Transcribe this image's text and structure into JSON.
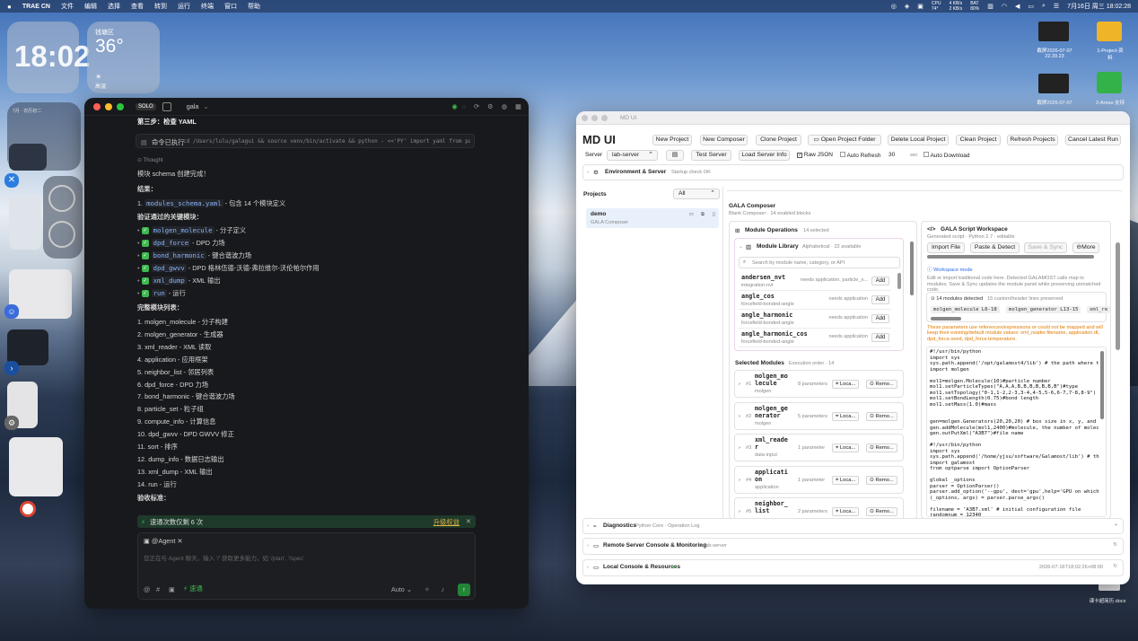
{
  "menubar": {
    "app": "TRAE CN",
    "items": [
      "文件",
      "编辑",
      "选择",
      "查看",
      "转到",
      "运行",
      "终端",
      "窗口",
      "帮助"
    ],
    "cpu_label": "CPU",
    "cpu_temp": "74°",
    "net_up": "4 KB/s",
    "net_down": "2 KB/s",
    "battery_label": "BAT",
    "battery": "80%",
    "datetime": "7月16日 周三 18:02:28"
  },
  "widgets": {
    "clock": "18:02",
    "weather_city": "钱塘区",
    "weather_temp": "36°",
    "weather_cond": "高温",
    "calendar_title": "7月 · 农历初二"
  },
  "desktop_files": [
    {
      "name": "截屏2026-07-07",
      "sub": "22.39.23"
    },
    {
      "name": "1-Project-资",
      "sub": "料"
    },
    {
      "name": "截屏2026-07-07",
      "sub": ""
    },
    {
      "name": "2-Areas-支持",
      "sub": ""
    },
    {
      "name": "课卡超简历.docx",
      "sub": ""
    }
  ],
  "trae": {
    "project": "gala",
    "solo": "SOLO",
    "step": "第三步：检查 YAML",
    "command_label": "命令已执行",
    "command": "cd /Users/lulu/galagui && source venv/bin/activate && python - <<'PY' import yaml from pathlib import Path p = P...",
    "thought": "Thought",
    "done": "模块 schema 创建完成！",
    "result_title": "结果：",
    "result_item_num": "1.",
    "result_file": "modules_schema.yaml",
    "result_desc": "- 包含 14 个模块定义",
    "verified_title": "验证通过的关键模块：",
    "verified": [
      {
        "code": "molgen_molecule",
        "desc": "- 分子定义"
      },
      {
        "code": "dpd_force",
        "desc": "- DPD 力场"
      },
      {
        "code": "bond_harmonic",
        "desc": "- 键合谐波力场"
      },
      {
        "code": "dpd_gwvv",
        "desc": "- DPD 格林伍德-沃德-弗拉维尔-沃伦帕尔作用"
      },
      {
        "code": "xml_dump",
        "desc": "- XML 输出"
      },
      {
        "code": "run",
        "desc": "- 运行"
      }
    ],
    "full_title": "完整模块列表：",
    "modules": [
      {
        "num": "1.",
        "text": "molgen_molecule - 分子构建"
      },
      {
        "num": "2.",
        "text": "molgen_generator - 生成器"
      },
      {
        "num": "3.",
        "text": "xml_reader - XML 读取"
      },
      {
        "num": "4.",
        "text": "application - 应用框架"
      },
      {
        "num": "5.",
        "text": "neighbor_list - 邻居列表"
      },
      {
        "num": "6.",
        "text": "dpd_force - DPD 力场"
      },
      {
        "num": "7.",
        "text": "bond_harmonic - 键合谐波力场"
      },
      {
        "num": "8.",
        "text": "particle_set - 粒子组"
      },
      {
        "num": "9.",
        "text": "compute_info - 计算信息"
      },
      {
        "num": "10.",
        "text": "dpd_gwvv - DPD GWVV 修正"
      },
      {
        "num": "11.",
        "text": "sort - 排序"
      },
      {
        "num": "12.",
        "text": "dump_info - 数据日志输出"
      },
      {
        "num": "13.",
        "text": "xml_dump - XML 输出"
      },
      {
        "num": "14.",
        "text": "run - 运行"
      }
    ],
    "accept_title": "验收标准：",
    "quota": "速通次数仅剩 6 次",
    "upgrade": "升级权益",
    "agent": "@Agent",
    "input_placeholder": "您正在与 Agent 聊天，输入 '/' 获取更多能力，如 '/plan', '/spec'",
    "mode": "Auto",
    "speed": "速通"
  },
  "md": {
    "window_title": "MD UI",
    "app_title": "MD UI",
    "toolbar": [
      "New Project",
      "New Composer",
      "Clone Project",
      "Open Project Folder",
      "Delete Local Project",
      "Clean Project",
      "Refresh Projects",
      "Cancel Latest Run"
    ],
    "server_label": "Server",
    "server_value": "lab-server",
    "test_server": "Test Server",
    "load_info": "Load Server Info",
    "raw_json": "Raw JSON",
    "auto_refresh": "Auto Refresh",
    "refresh_value": "30",
    "sec": "sec",
    "auto_download": "Auto Download",
    "env_title": "Environment & Server",
    "env_status": "Startup check OK",
    "projects_title": "Projects",
    "projects_filter": "All",
    "project_name": "demo",
    "project_sub": "GALA Composer",
    "composer_title": "GALA Composer",
    "composer_sub": "Blank Composer · 14 enabled blocks",
    "module_ops": "Module Operations",
    "module_ops_count": "14 selected",
    "library_title": "Module Library",
    "library_sub": "Alphabetical · 22 available",
    "search_placeholder": "Search by module name, category, or API",
    "library": [
      {
        "name": "andersen_nvt",
        "cat": "integration-nvt",
        "note": "needs application, particle_s...",
        "add": "Add"
      },
      {
        "name": "angle_cos",
        "cat": "forcefield-bonded-angle",
        "note": "needs application",
        "add": "Add"
      },
      {
        "name": "angle_harmonic",
        "cat": "forcefield-bonded-angle",
        "note": "needs application",
        "add": "Add"
      },
      {
        "name": "angle_harmonic_cos",
        "cat": "forcefield-bonded-angle",
        "note": "needs application",
        "add": "Add"
      }
    ],
    "selected_title": "Selected Modules",
    "selected_sub": "Execution order · 14",
    "selected": [
      {
        "num": "#1",
        "name1": "molgen_mo",
        "name2": "lecule",
        "cat": "molgen",
        "params": "8 parameters",
        "loc": "Loca...",
        "rem": "Remo..."
      },
      {
        "num": "#2",
        "name1": "molgen_ge",
        "name2": "nerator",
        "cat": "molgen",
        "params": "5 parameters",
        "loc": "Loca...",
        "rem": "Remo..."
      },
      {
        "num": "#3",
        "name1": "xml_reade",
        "name2": "r",
        "cat": "data-input",
        "params": "1 parameter",
        "loc": "Loca...",
        "rem": "Remo..."
      },
      {
        "num": "#4",
        "name1": "applicati",
        "name2": "on",
        "cat": "application",
        "params": "1 parameter",
        "loc": "Loca...",
        "rem": "Remo..."
      },
      {
        "num": "#5",
        "name1": "neighbor_",
        "name2": "list",
        "cat": "",
        "params": "2 parameters",
        "loc": "Loca...",
        "rem": "Remo..."
      }
    ],
    "script_title": "GALA Script Workspace",
    "script_sub": "Generated script · Python 2.7 · editable",
    "import_file": "Import File",
    "paste_detect": "Paste & Detect",
    "save_sync": "Save & Sync",
    "more": "More",
    "workspace_mode": "Workspace mode",
    "workspace_desc": "Edit or import traditional code here. Detected GALAMOST calls map to modules; Save & Sync updates the module panel while preserving unmatched code.",
    "detected": "14 modules detected",
    "preserved": "15 custom/header lines preserved",
    "chips": [
      "molgen_molecule  L6-18",
      "molgen_generator  L13-15",
      "xml_re"
    ],
    "warning": "These parameters use references/expressions or could not be mapped and will keep their existing/default module values: xml_reader.filename, application.dt, dpd_force.seed, dpd_force.temperature.",
    "code": "#!/usr/bin/python\nimport sys\nsys.path.append('/opt/galamost4/lib') # the path where t\nimport molgen\n\nmol1=molgen.Molecule(10)#particle number\nmol1.setParticleTypes(\"A,A,A,B,B,B,B,B,B,B\")#type\nmol1.setTopology(\"0-1,1-2,2-3,3-4,4-5,5-6,6-7,7-8,8-9\")\nmol1.setBondLength(0.75)#bond length\nmol1.setMass(1.0)#mass\n\n\ngen=molgen.Generators(20,20,20) # box size in x, y, and\ngen.addMolecule(mol1,2400)#molecule, the number of molec\ngen.outPutXml(\"A3B7\")#file name\n\n#!/usr/bin/python\nimport sys\nsys.path.append('/home/yjsu/software/Galamost/lib') # th\nimport galamost\nfrom optparse import OptionParser\n\nglobal _options\nparser = OptionParser()\nparser.add_option('--gpu', dest='gpu',help='GPU on which\n(_options, args) = parser.parse_args()\n\nfilename = 'A3B7.xml' # initial configuration file\nrandomnum = 12340\nbuild_method = galamost.XmlReader(filename)",
    "diagnostics": "Diagnostics",
    "diagnostics_sub": "Python Core · Operation Log",
    "remote": "Remote Server Console & Monitoring",
    "remote_sub": "lab-server",
    "local": "Local Console & Resources",
    "local_time": "2026-07-16T18:02:26+08:00"
  }
}
